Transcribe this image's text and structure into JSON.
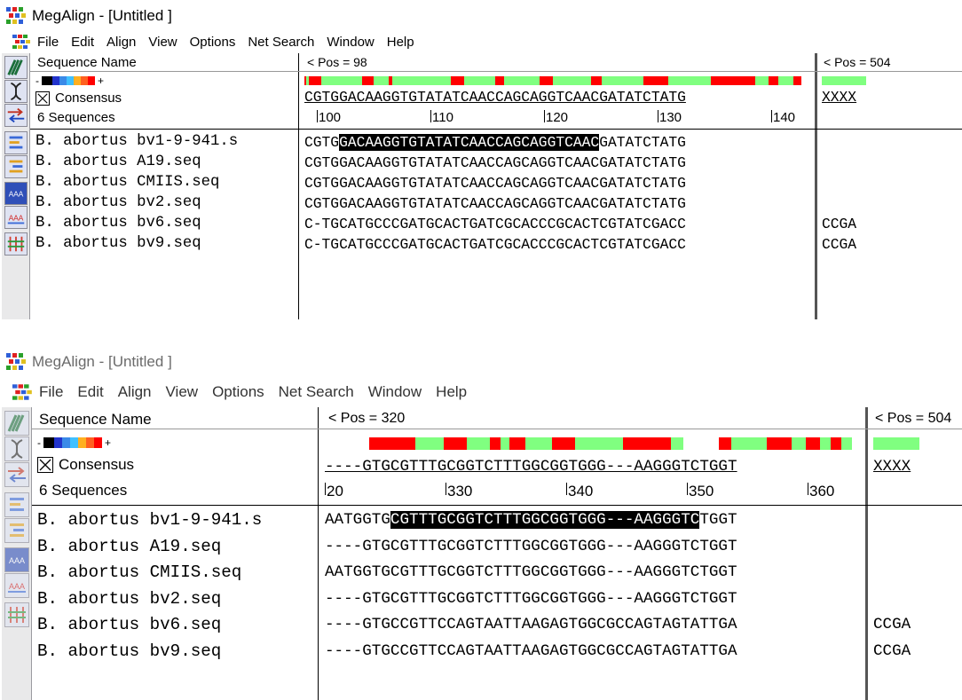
{
  "windows": [
    {
      "title": "MegAlign - [Untitled ]",
      "menu": [
        "File",
        "Edit",
        "Align",
        "View",
        "Options",
        "Net Search",
        "Window",
        "Help"
      ],
      "pane_header_name": "Sequence Name",
      "pane_header_pos": "< Pos = 98",
      "pane_header_pos2": "< Pos = 504",
      "consensus_label": "Consensus",
      "sequence_count": "6 Sequences",
      "consensus_seq": "CGTGGACAAGGTGTATATCAACCAGCAGGTCAACGATATCTATG",
      "consensus_seq2": "XXXX",
      "ruler_labels": [
        "100",
        "110",
        "120",
        "130",
        "140"
      ],
      "rows": [
        {
          "name": "B. abortus bv1-9-941.s",
          "pre": "CGTG",
          "hl": "GACAAGGTGTATATCAACCAGCAGGTCAAC",
          "post": "GATATCTATG",
          "extra": ""
        },
        {
          "name": "B. abortus A19.seq",
          "pre": "CGTGGACAAGGTGTATATCAACCAGCAGGTCAACGATATCTATG",
          "hl": "",
          "post": "",
          "extra": ""
        },
        {
          "name": "B. abortus CMIIS.seq",
          "pre": "CGTGGACAAGGTGTATATCAACCAGCAGGTCAACGATATCTATG",
          "hl": "",
          "post": "",
          "extra": ""
        },
        {
          "name": "B. abortus bv2.seq",
          "pre": "CGTGGACAAGGTGTATATCAACCAGCAGGTCAACGATATCTATG",
          "hl": "",
          "post": "",
          "extra": ""
        },
        {
          "name": "B. abortus bv6.seq",
          "pre": "C-TGCATGCCCGATGCACTGATCGCACCCGCACTCGTATCGACC",
          "hl": "",
          "post": "",
          "extra": "CCGA"
        },
        {
          "name": "B. abortus bv9.seq",
          "pre": "C-TGCATGCCCGATGCACTGATCGCACCCGCACTCGTATCGACC",
          "hl": "",
          "post": "",
          "extra": "CCGA"
        }
      ]
    },
    {
      "title": "MegAlign - [Untitled ]",
      "menu": [
        "File",
        "Edit",
        "Align",
        "View",
        "Options",
        "Net Search",
        "Window",
        "Help"
      ],
      "pane_header_name": "Sequence Name",
      "pane_header_pos": "< Pos = 320",
      "pane_header_pos2": "< Pos = 504",
      "consensus_label": "Consensus",
      "sequence_count": "6 Sequences",
      "consensus_seq": "----GTGCGTTTGCGGTCTTTGGCGGTGGG---AAGGGTCTGGT",
      "consensus_seq2": "XXXX",
      "ruler_labels": [
        "20",
        "330",
        "340",
        "350",
        "360"
      ],
      "rows": [
        {
          "name": "B. abortus bv1-9-941.s",
          "pre": "AATGGTG",
          "hl": "CGTTTGCGGTCTTTGGCGGTGGG---AAGGGTC",
          "post": "TGGT",
          "extra": ""
        },
        {
          "name": "B. abortus A19.seq",
          "pre": "----GTGCGTTTGCGGTCTTTGGCGGTGGG---AAGGGTCTGGT",
          "hl": "",
          "post": "",
          "extra": ""
        },
        {
          "name": "B. abortus CMIIS.seq",
          "pre": "AATGGTGCGTTTGCGGTCTTTGGCGGTGGG---AAGGGTCTGGT",
          "hl": "",
          "post": "",
          "extra": ""
        },
        {
          "name": "B. abortus bv2.seq",
          "pre": "----GTGCGTTTGCGGTCTTTGGCGGTGGG---AAGGGTCTGGT",
          "hl": "",
          "post": "",
          "extra": ""
        },
        {
          "name": "B. abortus bv6.seq",
          "pre": "----GTGCCGTTCCAGTAATTAAGAGTGGCGCCAGTAGTATTGA",
          "hl": "",
          "post": "",
          "extra": "CCGA"
        },
        {
          "name": "B. abortus bv9.seq",
          "pre": "----GTGCCGTTCCAGTAATTAAGAGTGGCGCCAGTAGTATTGA",
          "hl": "",
          "post": "",
          "extra": "CCGA"
        }
      ]
    }
  ],
  "colors": {
    "conserved": "#ff0000",
    "variable": "#80ff80",
    "highlight": "#000000"
  },
  "icons": [
    "align-icon",
    "dna-icon",
    "arrows-icon",
    "tree-up-icon",
    "tree-down-icon",
    "aaa-blue-icon",
    "aaa-red-icon",
    "grid-icon"
  ]
}
